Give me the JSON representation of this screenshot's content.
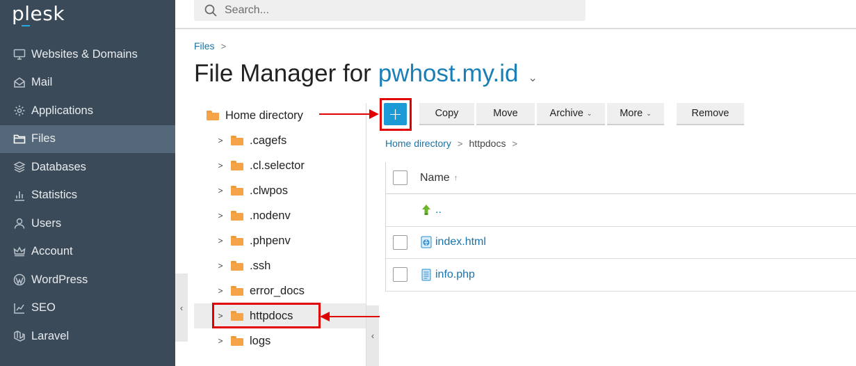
{
  "brand": {
    "logo": "plesk"
  },
  "sidebar": {
    "items": [
      {
        "label": "Websites & Domains",
        "icon": "monitor-icon"
      },
      {
        "label": "Mail",
        "icon": "envelope-icon"
      },
      {
        "label": "Applications",
        "icon": "gear-icon"
      },
      {
        "label": "Files",
        "icon": "folder-icon",
        "active": true
      },
      {
        "label": "Databases",
        "icon": "database-icon"
      },
      {
        "label": "Statistics",
        "icon": "bar-chart-icon"
      },
      {
        "label": "Users",
        "icon": "user-icon"
      },
      {
        "label": "Account",
        "icon": "crown-icon"
      },
      {
        "label": "WordPress",
        "icon": "wordpress-icon"
      },
      {
        "label": "SEO",
        "icon": "seo-chart-icon"
      },
      {
        "label": "Laravel",
        "icon": "laravel-icon"
      }
    ]
  },
  "search": {
    "placeholder": "Search..."
  },
  "breadcrumb": {
    "files": "Files",
    "sep": ">"
  },
  "title": {
    "prefix": "File Manager for",
    "domain": "pwhost.my.id",
    "caret": "⌄"
  },
  "tree": {
    "root": "Home directory",
    "children": [
      ".cagefs",
      ".cl.selector",
      ".clwpos",
      ".nodenv",
      ".phpenv",
      ".ssh",
      "error_docs",
      "httpdocs",
      "logs"
    ],
    "selected": "httpdocs"
  },
  "toolbar": {
    "add": "+",
    "copy": "Copy",
    "move": "Move",
    "archive": "Archive",
    "more": "More",
    "remove": "Remove",
    "dropdown_glyph": "⌄"
  },
  "path": {
    "home": "Home directory",
    "current": "httpdocs",
    "sep": ">"
  },
  "table": {
    "header": {
      "name": "Name",
      "sort": "↑"
    },
    "rows": [
      {
        "name": "..",
        "type": "up-dir",
        "icon": "up-arrow-icon",
        "checkbox": false
      },
      {
        "name": "index.html",
        "type": "html",
        "icon": "html-file-icon",
        "checkbox": true
      },
      {
        "name": "info.php",
        "type": "php",
        "icon": "text-file-icon",
        "checkbox": true
      }
    ]
  },
  "colors": {
    "sidebar_bg": "#3b4a58",
    "sidebar_active": "#55687a",
    "link": "#1a73a8",
    "accent": "#1c9ad6",
    "annotation": "#e00000",
    "folder": "#f5a347"
  }
}
